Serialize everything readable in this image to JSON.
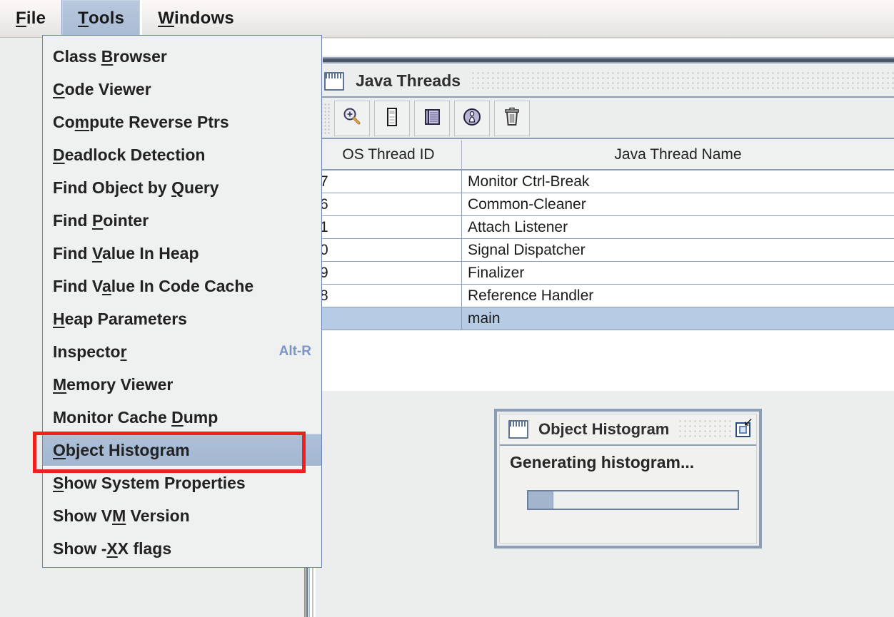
{
  "menubar": {
    "items": [
      {
        "label": "File",
        "mnemonic": "F",
        "active": false
      },
      {
        "label": "Tools",
        "mnemonic": "T",
        "active": true
      },
      {
        "label": "Windows",
        "mnemonic": "W",
        "active": false
      }
    ]
  },
  "tools_menu": {
    "items": [
      {
        "label": "Class Browser",
        "mnemonic": "B",
        "accel": "",
        "highlighted": false
      },
      {
        "label": "Code Viewer",
        "mnemonic": "C",
        "accel": "",
        "highlighted": false
      },
      {
        "label": "Compute Reverse Ptrs",
        "mnemonic": "m",
        "accel": "",
        "highlighted": false
      },
      {
        "label": "Deadlock Detection",
        "mnemonic": "D",
        "accel": "",
        "highlighted": false
      },
      {
        "label": "Find Object by Query",
        "mnemonic": "Q",
        "accel": "",
        "highlighted": false
      },
      {
        "label": "Find Pointer",
        "mnemonic": "P",
        "accel": "",
        "highlighted": false
      },
      {
        "label": "Find Value In Heap",
        "mnemonic": "V",
        "accel": "",
        "highlighted": false
      },
      {
        "label": "Find Value In Code Cache",
        "mnemonic": "a",
        "accel": "",
        "highlighted": false
      },
      {
        "label": "Heap Parameters",
        "mnemonic": "H",
        "accel": "",
        "highlighted": false
      },
      {
        "label": "Inspector",
        "mnemonic": "r",
        "accel": "Alt-R",
        "highlighted": false
      },
      {
        "label": "Memory Viewer",
        "mnemonic": "M",
        "accel": "",
        "highlighted": false
      },
      {
        "label": "Monitor Cache Dump",
        "mnemonic": "D",
        "accel": "",
        "highlighted": false
      },
      {
        "label": "Object Histogram",
        "mnemonic": "O",
        "accel": "",
        "highlighted": true
      },
      {
        "label": "Show System Properties",
        "mnemonic": "S",
        "accel": "",
        "highlighted": false
      },
      {
        "label": "Show VM Version",
        "mnemonic": "M",
        "accel": "",
        "highlighted": false
      },
      {
        "label": "Show -XX flags",
        "mnemonic": "X",
        "accel": "",
        "highlighted": false
      }
    ]
  },
  "java_threads_panel": {
    "title": "Java Threads",
    "toolbar": [
      {
        "name": "inspect-thread-button",
        "icon": "magnifier-plus-icon"
      },
      {
        "name": "memory-button",
        "icon": "memory-card-icon"
      },
      {
        "name": "stack-memory-button",
        "icon": "notebook-stack-icon"
      },
      {
        "name": "thread-info-button",
        "icon": "thread-info-icon"
      },
      {
        "name": "delete-button",
        "icon": "trash-icon"
      }
    ],
    "table": {
      "columns": [
        "OS Thread ID",
        "Java Thread Name"
      ],
      "rows": [
        {
          "os_thread_id": "7",
          "java_thread_name": "Monitor Ctrl-Break",
          "selected": false
        },
        {
          "os_thread_id": "6",
          "java_thread_name": "Common-Cleaner",
          "selected": false
        },
        {
          "os_thread_id": "1",
          "java_thread_name": "Attach Listener",
          "selected": false
        },
        {
          "os_thread_id": "0",
          "java_thread_name": "Signal Dispatcher",
          "selected": false
        },
        {
          "os_thread_id": "9",
          "java_thread_name": "Finalizer",
          "selected": false
        },
        {
          "os_thread_id": "8",
          "java_thread_name": "Reference Handler",
          "selected": false
        },
        {
          "os_thread_id": "",
          "java_thread_name": "main",
          "selected": true
        }
      ]
    }
  },
  "object_histogram_dialog": {
    "title": "Object Histogram",
    "message": "Generating histogram...",
    "progress_percent": 12,
    "maximize_label": "",
    "resize_glyph": "↙"
  },
  "colors": {
    "accent": "#a4b7d2",
    "selection": "#b6cbe4",
    "annotation": "#ee2020",
    "accel_text": "#7b95c4",
    "frame_border": "#8c9db6"
  }
}
